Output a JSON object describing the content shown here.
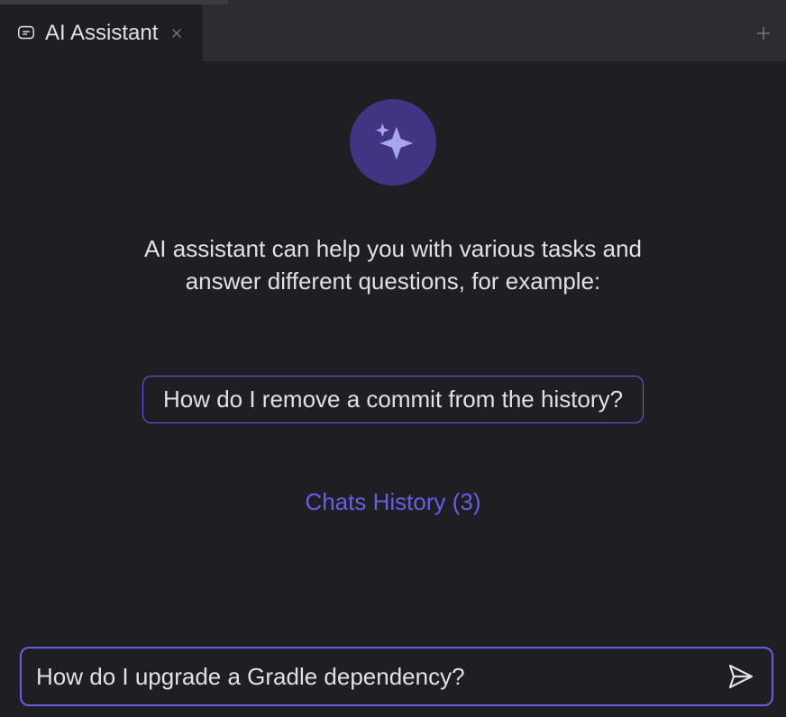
{
  "tab": {
    "label": "AI Assistant"
  },
  "intro": {
    "text": "AI assistant can help you with various tasks and answer different questions, for example:"
  },
  "example": {
    "label": "How do I remove a commit from the history?"
  },
  "history": {
    "label": "Chats History (3)"
  },
  "input": {
    "value": "How do I upgrade a Gradle dependency?"
  }
}
